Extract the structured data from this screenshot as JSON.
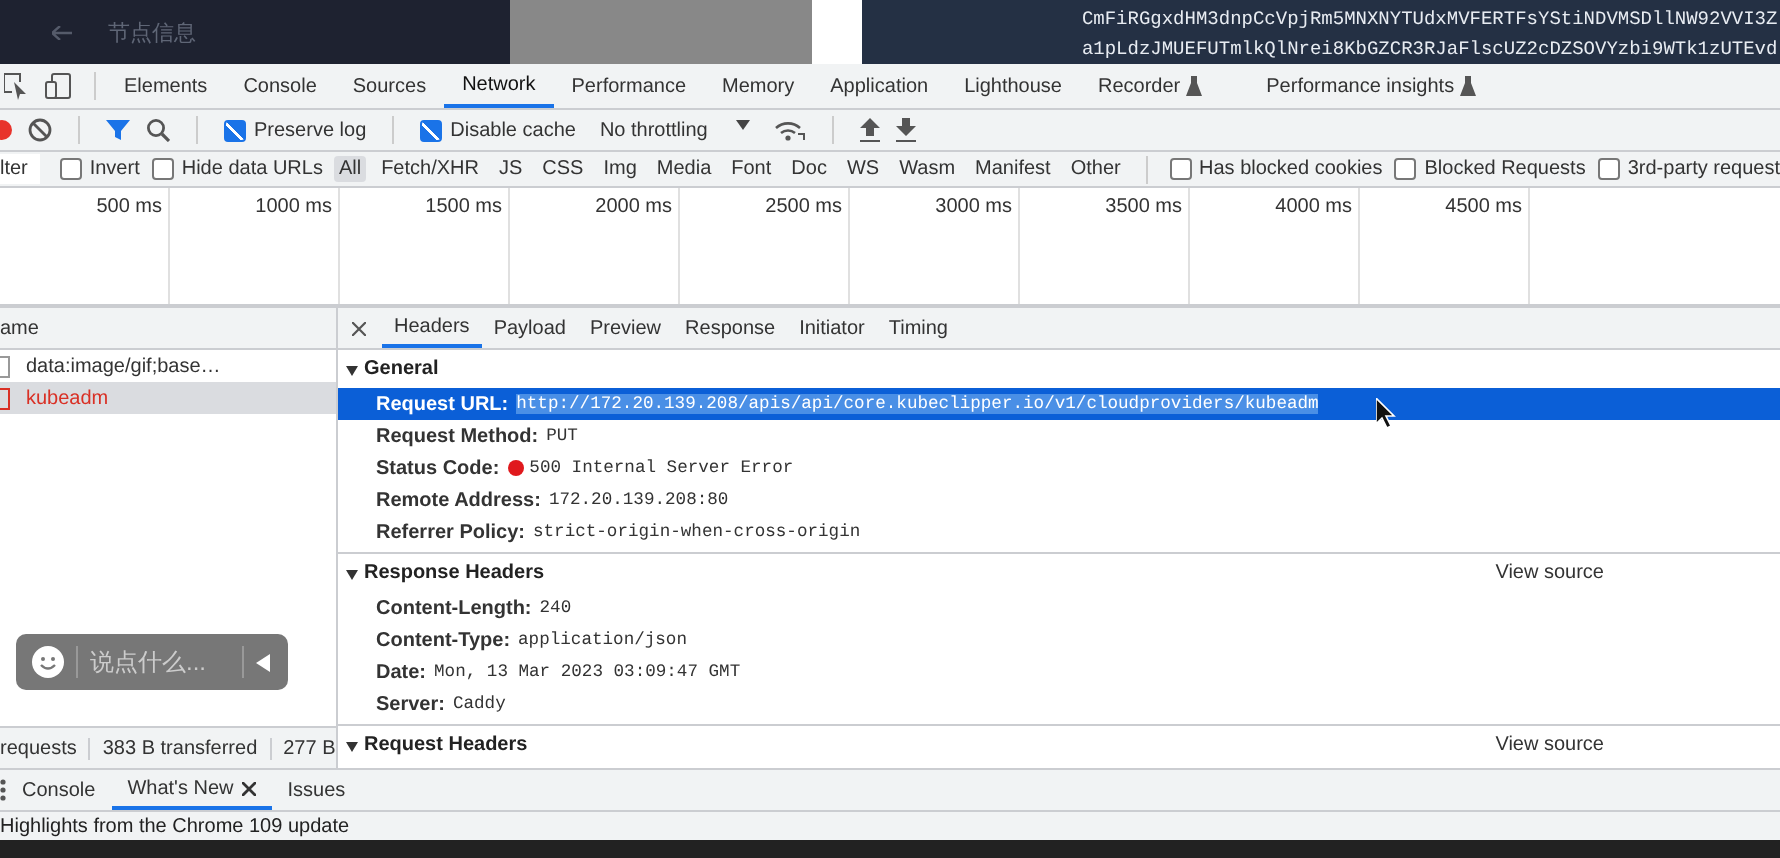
{
  "background": {
    "breadcrumb": "节点信息",
    "code_lines": [
      "CmFiRGgxdHM3dnpCcVpjRm5MNXNYTUdxMVFERTFsYStiNDVMSDllNW92VVI3Z",
      "a1pLdzJMUEFUTmlkQlNrei8KbGZCR3RJaFlscUZ2cDZSOVYzbi9WTk1zUTEvd"
    ]
  },
  "panel_tabs": [
    {
      "label": "Elements",
      "selected": false,
      "experimental": false
    },
    {
      "label": "Console",
      "selected": false,
      "experimental": false
    },
    {
      "label": "Sources",
      "selected": false,
      "experimental": false
    },
    {
      "label": "Network",
      "selected": true,
      "experimental": false
    },
    {
      "label": "Performance",
      "selected": false,
      "experimental": false
    },
    {
      "label": "Memory",
      "selected": false,
      "experimental": false
    },
    {
      "label": "Application",
      "selected": false,
      "experimental": false
    },
    {
      "label": "Lighthouse",
      "selected": false,
      "experimental": false
    },
    {
      "label": "Recorder",
      "selected": false,
      "experimental": true
    },
    {
      "label": "Performance insights",
      "selected": false,
      "experimental": true
    }
  ],
  "toolbar": {
    "recording": true,
    "preserve_log": {
      "label": "Preserve log",
      "checked": true
    },
    "disable_cache": {
      "label": "Disable cache",
      "checked": true
    },
    "throttling": "No throttling"
  },
  "filter_bar": {
    "placeholder": "lter",
    "checks_before": [
      {
        "label": "Invert",
        "checked": false
      },
      {
        "label": "Hide data URLs",
        "checked": false
      }
    ],
    "types": [
      {
        "label": "All",
        "selected": true
      },
      {
        "label": "Fetch/XHR",
        "selected": false
      },
      {
        "label": "JS",
        "selected": false
      },
      {
        "label": "CSS",
        "selected": false
      },
      {
        "label": "Img",
        "selected": false
      },
      {
        "label": "Media",
        "selected": false
      },
      {
        "label": "Font",
        "selected": false
      },
      {
        "label": "Doc",
        "selected": false
      },
      {
        "label": "WS",
        "selected": false
      },
      {
        "label": "Wasm",
        "selected": false
      },
      {
        "label": "Manifest",
        "selected": false
      },
      {
        "label": "Other",
        "selected": false
      }
    ],
    "checks_after": [
      {
        "label": "Has blocked cookies",
        "checked": false
      },
      {
        "label": "Blocked Requests",
        "checked": false
      },
      {
        "label": "3rd-party request",
        "checked": false
      }
    ]
  },
  "timeline_ticks": [
    "500 ms",
    "1000 ms",
    "1500 ms",
    "2000 ms",
    "2500 ms",
    "3000 ms",
    "3500 ms",
    "4000 ms",
    "4500 ms"
  ],
  "requests": {
    "column": "ame",
    "rows": [
      {
        "name": "data:image/gif;base…",
        "error": false,
        "selected": false
      },
      {
        "name": "kubeadm",
        "error": true,
        "selected": true
      }
    ]
  },
  "status_bar": [
    "requests",
    "383 B transferred",
    "277 B"
  ],
  "chat_box": {
    "placeholder": "说点什么..."
  },
  "detail_tabs": [
    {
      "label": "Headers",
      "selected": true
    },
    {
      "label": "Payload",
      "selected": false
    },
    {
      "label": "Preview",
      "selected": false
    },
    {
      "label": "Response",
      "selected": false
    },
    {
      "label": "Initiator",
      "selected": false
    },
    {
      "label": "Timing",
      "selected": false
    }
  ],
  "sections": [
    {
      "title": "General",
      "expanded": true,
      "rows": [
        {
          "label": "Request URL:",
          "value": "http://172.20.139.208/apis/api/core.kubeclipper.io/v1/cloudproviders/kubeadm",
          "selected": true
        },
        {
          "label": "Request Method:",
          "value": "PUT",
          "selected": false
        },
        {
          "label": "Status Code:",
          "value": "500 Internal Server Error",
          "selected": false,
          "color": "#e0191d"
        },
        {
          "label": "Remote Address:",
          "value": "172.20.139.208:80",
          "selected": false
        },
        {
          "label": "Referrer Policy:",
          "value": "strict-origin-when-cross-origin",
          "selected": false
        }
      ]
    },
    {
      "title": "Response Headers",
      "expanded": true,
      "view_source": "View source",
      "rows": [
        {
          "label": "Content-Length:",
          "value": "240",
          "selected": false
        },
        {
          "label": "Content-Type:",
          "value": "application/json",
          "selected": false
        },
        {
          "label": "Date:",
          "value": "Mon, 13 Mar 2023 03:09:47 GMT",
          "selected": false
        },
        {
          "label": "Server:",
          "value": "Caddy",
          "selected": false
        }
      ]
    },
    {
      "title": "Request Headers",
      "expanded": true,
      "view_source": "View source"
    }
  ],
  "drawer_tabs": [
    {
      "label": "Console",
      "selected": false,
      "closable": false
    },
    {
      "label": "What's New",
      "selected": true,
      "closable": true
    },
    {
      "label": "Issues",
      "selected": false,
      "closable": false
    }
  ],
  "drawer_text": "Highlights from the Chrome 109 update"
}
